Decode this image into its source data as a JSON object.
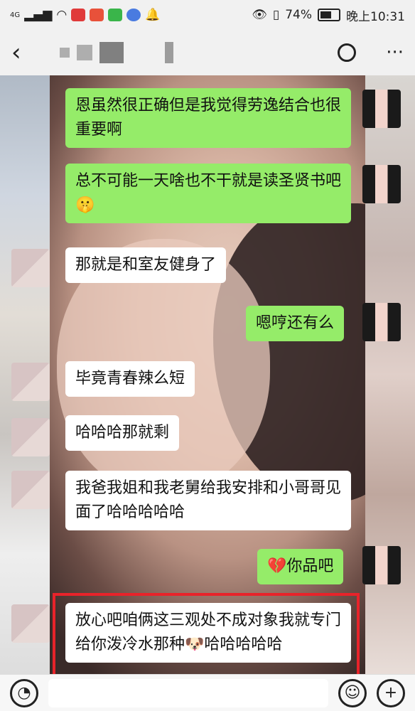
{
  "status_bar": {
    "network": "4G",
    "battery_pct": "74%",
    "battery_level": 0.74,
    "time": "晚上10:31"
  },
  "header": {
    "back_icon": "chevron-left-icon",
    "more": "···"
  },
  "messages": [
    {
      "side": "right",
      "text": "恩虽然很正确但是我觉得劳逸结合也很重要啊"
    },
    {
      "side": "right",
      "text": "总不可能一天啥也不干就是读圣贤书吧",
      "emoji": "🤫"
    },
    {
      "side": "left",
      "text": "那就是和室友健身了"
    },
    {
      "side": "right",
      "text": "嗯哼还有么"
    },
    {
      "side": "left",
      "text": "毕竟青春辣么短"
    },
    {
      "side": "left",
      "text": "哈哈哈那就剩"
    },
    {
      "side": "left",
      "text": "我爸我姐和我老舅给我安排和小哥哥见面了哈哈哈哈哈"
    },
    {
      "side": "right",
      "text": "你品吧",
      "emoji": "💔"
    },
    {
      "side": "left",
      "text_a": "放心吧咱俩这三观处不成对象我就专门给你泼冷水那种",
      "emoji": "🐶",
      "text_b": "哈哈哈哈哈",
      "highlighted": true
    }
  ],
  "colors": {
    "sent_bubble": "#95ec69",
    "received_bubble": "#ffffff",
    "highlight": "#e8232a"
  },
  "input_bar": {
    "voice_icon": "voice-icon",
    "emoji_icon": "smiley-icon",
    "add_icon": "plus-icon"
  }
}
